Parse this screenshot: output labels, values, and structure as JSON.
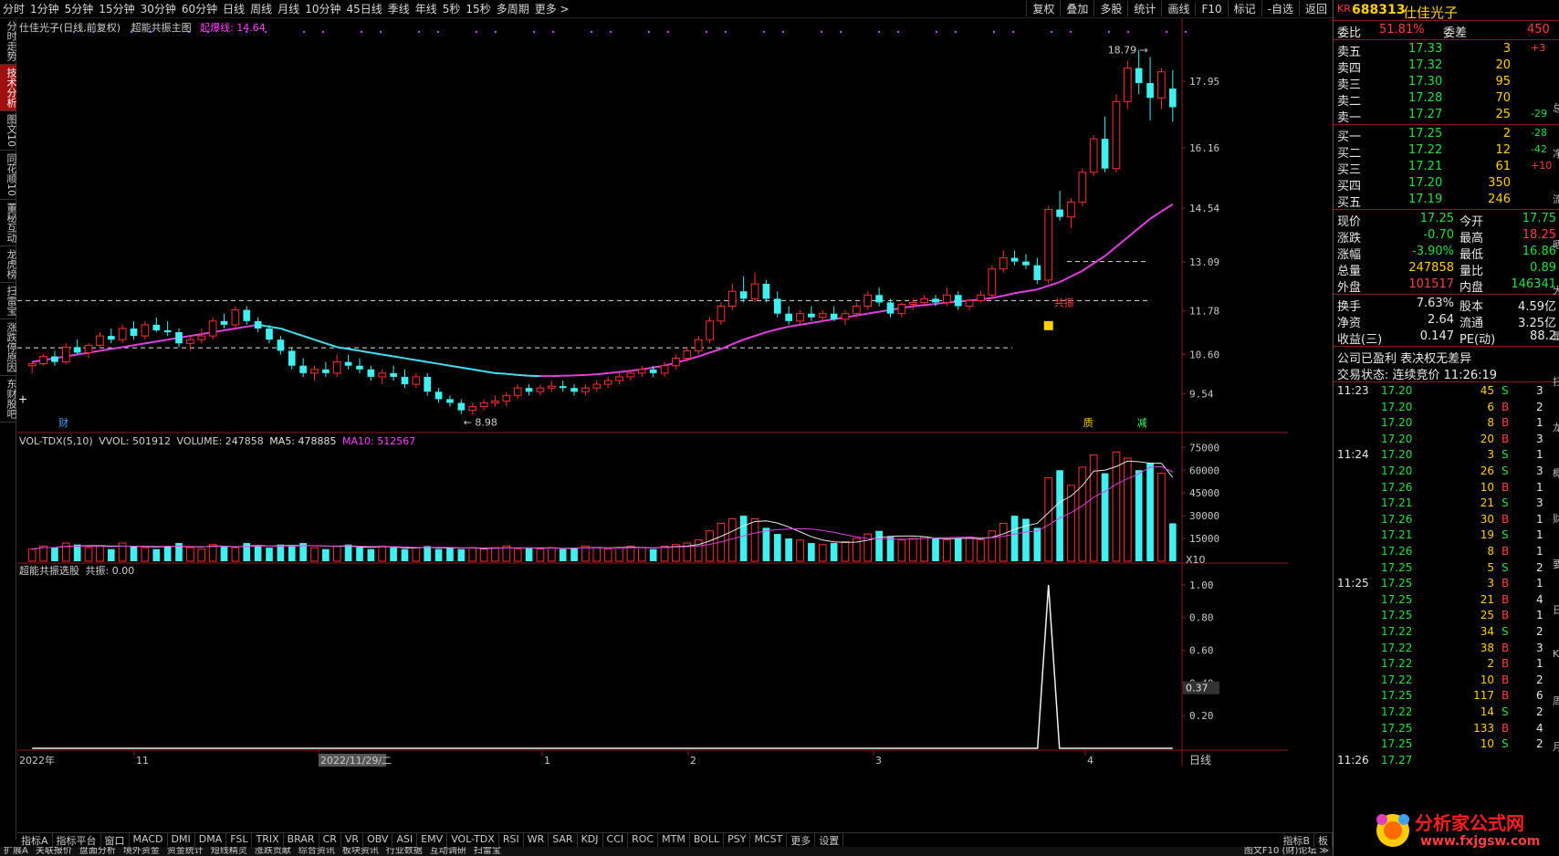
{
  "topbar": {
    "periods": [
      "分时",
      "1分钟",
      "5分钟",
      "15分钟",
      "30分钟",
      "60分钟",
      "日线",
      "周线",
      "月线",
      "10分钟",
      "45日线",
      "季线",
      "年线",
      "5秒",
      "15秒",
      "多周期",
      "更多 >"
    ],
    "right_buttons": [
      "复权",
      "叠加",
      "多股",
      "统计",
      "画线",
      "F10",
      "标记",
      "-自选",
      "返回"
    ]
  },
  "lefttabs": [
    {
      "label": "分时走势",
      "active": false
    },
    {
      "label": "技术分析",
      "active": true
    },
    {
      "label": "图文10",
      "active": false
    },
    {
      "label": "同花顺10",
      "active": false
    },
    {
      "label": "董秘互动",
      "active": false
    },
    {
      "label": "龙虎榜",
      "active": false
    },
    {
      "label": "扫雷宝",
      "active": false
    },
    {
      "label": "涨跌停原因",
      "active": false
    },
    {
      "label": "东财股吧",
      "active": false
    }
  ],
  "main_panel": {
    "title": "仕佳光子(日线,前复权)",
    "indicator": "超能共振主图",
    "line_label": "起爆线: 14.64",
    "high_label": "18.79",
    "low_label": "8.98",
    "price_ticks": [
      "17.95",
      "16.16",
      "14.54",
      "13.09",
      "11.78",
      "10.60",
      "9.54"
    ],
    "markers": {
      "cai": "财",
      "zhi": "质",
      "jian": "减",
      "zhen": "共振"
    }
  },
  "vol_panel": {
    "title": "VOL-TDX(5,10)",
    "vvol": "VVOL: 501912",
    "volume": "VOLUME: 247858",
    "ma5": "MA5: 478885",
    "ma10": "MA10: 512567",
    "ticks": [
      "75000",
      "60000",
      "45000",
      "30000",
      "15000"
    ],
    "unit": "X10"
  },
  "osc_panel": {
    "title": "超能共振选股",
    "value": "共振: 0.00",
    "ticks": [
      "1.00",
      "0.80",
      "0.60",
      "0.40",
      "0.20"
    ],
    "current": "0.37"
  },
  "date_axis": [
    "2022年",
    "11",
    "2022/11/29/二",
    "1",
    "2",
    "3",
    "4"
  ],
  "date_right": "日线",
  "bottom_tabs": [
    "指标A",
    "指标平台",
    "窗口",
    "MACD",
    "DMI",
    "DMA",
    "FSL",
    "TRIX",
    "BRAR",
    "CR",
    "VR",
    "OBV",
    "ASI",
    "EMV",
    "VOL-TDX",
    "RSI",
    "WR",
    "SAR",
    "KDJ",
    "CCI",
    "ROC",
    "MTM",
    "BOLL",
    "PSY",
    "MCST",
    "更多",
    "设置"
  ],
  "bottom_right": [
    "指标B",
    "板"
  ],
  "bottom_row2": [
    "扩展A",
    "关联报价",
    "盘面分析",
    "境外资金",
    "资金统计",
    "短线精灵",
    "涨跌贡献",
    "综合资讯",
    "板块资讯",
    "行业数据",
    "互动调研",
    "扫雷宝"
  ],
  "bottom_row2_right": "图文F10 (财)论坛 ≫",
  "quote": {
    "code": "688313",
    "name": "仕佳光子",
    "kr": "KR",
    "weibi_label": "委比",
    "weibi": "51.81%",
    "weicha_label": "委差",
    "weicha": "450",
    "asks": [
      {
        "label": "卖五",
        "price": "17.33",
        "vol": "3",
        "chg": "+3"
      },
      {
        "label": "卖四",
        "price": "17.32",
        "vol": "20",
        "chg": ""
      },
      {
        "label": "卖三",
        "price": "17.30",
        "vol": "95",
        "chg": ""
      },
      {
        "label": "卖二",
        "price": "17.28",
        "vol": "70",
        "chg": ""
      },
      {
        "label": "卖一",
        "price": "17.27",
        "vol": "25",
        "chg": "-29"
      }
    ],
    "bids": [
      {
        "label": "买一",
        "price": "17.25",
        "vol": "2",
        "chg": "-28"
      },
      {
        "label": "买二",
        "price": "17.22",
        "vol": "12",
        "chg": "-42"
      },
      {
        "label": "买三",
        "price": "17.21",
        "vol": "61",
        "chg": "+10"
      },
      {
        "label": "买四",
        "price": "17.20",
        "vol": "350",
        "chg": ""
      },
      {
        "label": "买五",
        "price": "17.19",
        "vol": "246",
        "chg": ""
      }
    ],
    "stats": [
      {
        "l1": "现价",
        "v1": "17.25",
        "l2": "今开",
        "v2": "17.75"
      },
      {
        "l1": "涨跌",
        "v1": "-0.70",
        "l2": "最高",
        "v2": "18.25"
      },
      {
        "l1": "涨幅",
        "v1": "-3.90%",
        "l2": "最低",
        "v2": "16.86"
      },
      {
        "l1": "总量",
        "v1": "247858",
        "l2": "量比",
        "v2": "0.89"
      },
      {
        "l1": "外盘",
        "v1": "101517",
        "l2": "内盘",
        "v2": "146341"
      }
    ],
    "stats2": [
      {
        "l1": "换手",
        "v1": "7.63%",
        "l2": "股本",
        "v2": "4.59亿"
      },
      {
        "l1": "净资",
        "v1": "2.64",
        "l2": "流通",
        "v2": "3.25亿"
      },
      {
        "l1": "收益(三)",
        "v1": "0.147",
        "l2": "PE(动)",
        "v2": "88.2"
      }
    ],
    "note1": "公司已盈利 表决权无差异",
    "note2": "交易状态: 连续竞价 11:26:19",
    "ticks": [
      {
        "t": "11:23",
        "p": "17.20",
        "v": "45",
        "s": "S",
        "n": "3"
      },
      {
        "t": "",
        "p": "17.20",
        "v": "6",
        "s": "B",
        "n": "2"
      },
      {
        "t": "",
        "p": "17.20",
        "v": "8",
        "s": "B",
        "n": "1"
      },
      {
        "t": "",
        "p": "17.20",
        "v": "20",
        "s": "B",
        "n": "3"
      },
      {
        "t": "11:24",
        "p": "17.20",
        "v": "3",
        "s": "S",
        "n": "1"
      },
      {
        "t": "",
        "p": "17.20",
        "v": "26",
        "s": "S",
        "n": "3"
      },
      {
        "t": "",
        "p": "17.26",
        "v": "10",
        "s": "B",
        "n": "1"
      },
      {
        "t": "",
        "p": "17.21",
        "v": "21",
        "s": "S",
        "n": "3"
      },
      {
        "t": "",
        "p": "17.26",
        "v": "30",
        "s": "B",
        "n": "1"
      },
      {
        "t": "",
        "p": "17.21",
        "v": "19",
        "s": "S",
        "n": "1"
      },
      {
        "t": "",
        "p": "17.26",
        "v": "8",
        "s": "B",
        "n": "1"
      },
      {
        "t": "",
        "p": "17.25",
        "v": "5",
        "s": "S",
        "n": "2"
      },
      {
        "t": "11:25",
        "p": "17.25",
        "v": "3",
        "s": "B",
        "n": "1"
      },
      {
        "t": "",
        "p": "17.25",
        "v": "21",
        "s": "B",
        "n": "4"
      },
      {
        "t": "",
        "p": "17.25",
        "v": "25",
        "s": "B",
        "n": "1"
      },
      {
        "t": "",
        "p": "17.22",
        "v": "34",
        "s": "S",
        "n": "2"
      },
      {
        "t": "",
        "p": "17.22",
        "v": "38",
        "s": "B",
        "n": "3"
      },
      {
        "t": "",
        "p": "17.22",
        "v": "2",
        "s": "B",
        "n": "1"
      },
      {
        "t": "",
        "p": "17.22",
        "v": "10",
        "s": "B",
        "n": "2"
      },
      {
        "t": "",
        "p": "17.25",
        "v": "117",
        "s": "B",
        "n": "6"
      },
      {
        "t": "",
        "p": "17.22",
        "v": "14",
        "s": "S",
        "n": "2"
      },
      {
        "t": "",
        "p": "17.25",
        "v": "133",
        "s": "B",
        "n": "4"
      },
      {
        "t": "",
        "p": "17.25",
        "v": "10",
        "s": "S",
        "n": "2"
      },
      {
        "t": "11:26",
        "p": "17.27",
        "v": "",
        "s": "",
        "n": ""
      }
    ],
    "side_chars": [
      "总",
      "净",
      "流",
      "晒",
      "大",
      "量",
      "扫",
      "龙",
      "概",
      "财",
      "要",
      "日",
      "K",
      "周",
      "月"
    ],
    "side_header": "—"
  },
  "watermark": {
    "text": "分析家公式网",
    "url": "www.fxjgsw.com"
  },
  "chart_data": {
    "type": "candlestick",
    "price_range": [
      8.6,
      19.2
    ],
    "candles": [
      [
        10.3,
        10.4,
        10.1,
        10.35
      ],
      [
        10.35,
        10.6,
        10.3,
        10.55
      ],
      [
        10.55,
        10.7,
        10.3,
        10.4
      ],
      [
        10.4,
        10.9,
        10.35,
        10.8
      ],
      [
        10.8,
        11.0,
        10.6,
        10.65
      ],
      [
        10.65,
        10.9,
        10.5,
        10.85
      ],
      [
        10.85,
        11.2,
        10.8,
        11.1
      ],
      [
        11.1,
        11.3,
        10.9,
        11.0
      ],
      [
        11.0,
        11.4,
        10.9,
        11.3
      ],
      [
        11.3,
        11.5,
        11.0,
        11.1
      ],
      [
        11.1,
        11.5,
        11.0,
        11.4
      ],
      [
        11.4,
        11.6,
        11.2,
        11.25
      ],
      [
        11.25,
        11.5,
        11.1,
        11.2
      ],
      [
        11.2,
        11.3,
        10.8,
        10.9
      ],
      [
        10.9,
        11.1,
        10.7,
        11.0
      ],
      [
        11.0,
        11.3,
        10.9,
        11.1
      ],
      [
        11.1,
        11.6,
        11.0,
        11.5
      ],
      [
        11.5,
        11.7,
        11.3,
        11.4
      ],
      [
        11.4,
        11.9,
        11.3,
        11.8
      ],
      [
        11.8,
        11.9,
        11.4,
        11.5
      ],
      [
        11.5,
        11.6,
        11.2,
        11.3
      ],
      [
        11.3,
        11.4,
        10.9,
        11.0
      ],
      [
        11.0,
        11.1,
        10.6,
        10.7
      ],
      [
        10.7,
        10.8,
        10.2,
        10.3
      ],
      [
        10.3,
        10.5,
        10.0,
        10.1
      ],
      [
        10.1,
        10.3,
        9.9,
        10.2
      ],
      [
        10.2,
        10.4,
        10.0,
        10.1
      ],
      [
        10.1,
        10.6,
        10.0,
        10.4
      ],
      [
        10.4,
        10.6,
        10.2,
        10.3
      ],
      [
        10.3,
        10.5,
        10.1,
        10.2
      ],
      [
        10.2,
        10.3,
        9.9,
        10.0
      ],
      [
        10.0,
        10.2,
        9.8,
        10.1
      ],
      [
        10.1,
        10.3,
        9.9,
        10.0
      ],
      [
        10.0,
        10.2,
        9.7,
        9.8
      ],
      [
        9.8,
        10.1,
        9.7,
        10.0
      ],
      [
        10.0,
        10.1,
        9.5,
        9.6
      ],
      [
        9.6,
        9.7,
        9.3,
        9.4
      ],
      [
        9.4,
        9.5,
        9.2,
        9.3
      ],
      [
        9.3,
        9.4,
        9.0,
        9.1
      ],
      [
        9.1,
        9.3,
        8.98,
        9.2
      ],
      [
        9.2,
        9.4,
        9.1,
        9.3
      ],
      [
        9.3,
        9.5,
        9.2,
        9.35
      ],
      [
        9.35,
        9.6,
        9.2,
        9.5
      ],
      [
        9.5,
        9.8,
        9.4,
        9.7
      ],
      [
        9.7,
        9.8,
        9.5,
        9.6
      ],
      [
        9.6,
        9.8,
        9.5,
        9.7
      ],
      [
        9.7,
        9.9,
        9.6,
        9.75
      ],
      [
        9.75,
        9.9,
        9.6,
        9.7
      ],
      [
        9.7,
        9.8,
        9.5,
        9.6
      ],
      [
        9.6,
        9.8,
        9.5,
        9.7
      ],
      [
        9.7,
        9.9,
        9.6,
        9.8
      ],
      [
        9.8,
        10.0,
        9.7,
        9.9
      ],
      [
        9.9,
        10.1,
        9.8,
        10.0
      ],
      [
        10.0,
        10.2,
        9.9,
        10.1
      ],
      [
        10.1,
        10.3,
        10.0,
        10.2
      ],
      [
        10.2,
        10.3,
        10.0,
        10.1
      ],
      [
        10.1,
        10.4,
        10.0,
        10.3
      ],
      [
        10.3,
        10.6,
        10.2,
        10.5
      ],
      [
        10.5,
        10.8,
        10.4,
        10.7
      ],
      [
        10.7,
        11.1,
        10.6,
        11.0
      ],
      [
        11.0,
        11.6,
        10.9,
        11.5
      ],
      [
        11.5,
        12.0,
        11.4,
        11.9
      ],
      [
        11.9,
        12.5,
        11.8,
        12.3
      ],
      [
        12.3,
        12.7,
        12.0,
        12.1
      ],
      [
        12.1,
        12.8,
        12.0,
        12.5
      ],
      [
        12.5,
        12.6,
        12.0,
        12.1
      ],
      [
        12.1,
        12.3,
        11.6,
        11.7
      ],
      [
        11.7,
        11.9,
        11.4,
        11.5
      ],
      [
        11.5,
        11.8,
        11.4,
        11.7
      ],
      [
        11.7,
        11.9,
        11.5,
        11.6
      ],
      [
        11.6,
        11.8,
        11.5,
        11.7
      ],
      [
        11.7,
        11.9,
        11.5,
        11.55
      ],
      [
        11.55,
        11.8,
        11.4,
        11.7
      ],
      [
        11.7,
        12.0,
        11.6,
        11.9
      ],
      [
        11.9,
        12.3,
        11.8,
        12.2
      ],
      [
        12.2,
        12.4,
        11.9,
        12.0
      ],
      [
        12.0,
        12.1,
        11.6,
        11.7
      ],
      [
        11.7,
        12.0,
        11.6,
        11.95
      ],
      [
        11.95,
        12.1,
        11.8,
        12.0
      ],
      [
        12.0,
        12.2,
        11.9,
        12.1
      ],
      [
        12.1,
        12.2,
        11.9,
        12.0
      ],
      [
        12.0,
        12.4,
        11.9,
        12.2
      ],
      [
        12.2,
        12.3,
        11.8,
        11.9
      ],
      [
        11.9,
        12.1,
        11.8,
        12.05
      ],
      [
        12.05,
        12.3,
        12.0,
        12.2
      ],
      [
        12.2,
        13.0,
        12.1,
        12.9
      ],
      [
        12.9,
        13.4,
        12.8,
        13.2
      ],
      [
        13.2,
        13.4,
        13.0,
        13.1
      ],
      [
        13.1,
        13.3,
        12.9,
        13.0
      ],
      [
        13.0,
        13.2,
        12.5,
        12.6
      ],
      [
        12.6,
        14.6,
        12.5,
        14.5
      ],
      [
        14.5,
        15.0,
        14.2,
        14.3
      ],
      [
        14.3,
        14.8,
        14.0,
        14.7
      ],
      [
        14.7,
        15.6,
        14.6,
        15.5
      ],
      [
        15.5,
        16.5,
        15.4,
        16.4
      ],
      [
        16.4,
        17.0,
        15.5,
        15.6
      ],
      [
        15.6,
        17.6,
        15.5,
        17.4
      ],
      [
        17.4,
        18.5,
        17.2,
        18.3
      ],
      [
        18.3,
        18.79,
        17.6,
        17.9
      ],
      [
        17.9,
        18.6,
        16.9,
        17.5
      ],
      [
        17.5,
        18.3,
        17.2,
        18.2
      ],
      [
        17.75,
        18.25,
        16.86,
        17.25
      ]
    ],
    "ma_line": [
      10.4,
      10.45,
      10.5,
      10.55,
      10.6,
      10.65,
      10.7,
      10.75,
      10.8,
      10.85,
      10.9,
      10.95,
      11.0,
      11.05,
      11.1,
      11.15,
      11.2,
      11.25,
      11.3,
      11.35,
      11.4,
      11.35,
      11.3,
      11.2,
      11.1,
      11.0,
      10.9,
      10.8,
      10.75,
      10.7,
      10.65,
      10.6,
      10.55,
      10.5,
      10.45,
      10.4,
      10.35,
      10.3,
      10.25,
      10.2,
      10.15,
      10.1,
      10.08,
      10.05,
      10.03,
      10.02,
      10.02,
      10.03,
      10.04,
      10.05,
      10.07,
      10.1,
      10.13,
      10.16,
      10.2,
      10.25,
      10.3,
      10.38,
      10.46,
      10.55,
      10.65,
      10.75,
      10.88,
      11.0,
      11.1,
      11.2,
      11.28,
      11.35,
      11.4,
      11.45,
      11.5,
      11.55,
      11.6,
      11.65,
      11.7,
      11.75,
      11.8,
      11.85,
      11.9,
      11.93,
      11.96,
      12.0,
      12.02,
      12.05,
      12.08,
      12.12,
      12.18,
      12.25,
      12.3,
      12.35,
      12.45,
      12.55,
      12.7,
      12.85,
      13.05,
      13.25,
      13.5,
      13.75,
      14.0,
      14.25,
      14.45,
      14.64
    ],
    "volumes": [
      8,
      10,
      9,
      12,
      11,
      9,
      10,
      8,
      12,
      10,
      9,
      8,
      10,
      12,
      9,
      8,
      11,
      10,
      9,
      12,
      10,
      9,
      11,
      10,
      12,
      9,
      8,
      10,
      11,
      9,
      8,
      10,
      9,
      8,
      9,
      10,
      8,
      9,
      8,
      9,
      8,
      9,
      10,
      8,
      9,
      8,
      9,
      8,
      9,
      10,
      9,
      8,
      9,
      10,
      9,
      8,
      10,
      11,
      12,
      14,
      20,
      25,
      28,
      30,
      28,
      22,
      18,
      15,
      14,
      12,
      11,
      12,
      13,
      15,
      18,
      20,
      16,
      14,
      15,
      16,
      15,
      14,
      15,
      16,
      14,
      20,
      25,
      30,
      28,
      22,
      55,
      60,
      50,
      62,
      70,
      58,
      72,
      68,
      60,
      65,
      58,
      25
    ],
    "vol_range": [
      0,
      80
    ],
    "osc": {
      "peak_index": 90,
      "peak_value": 1.0,
      "range": [
        0,
        1.1
      ]
    }
  }
}
